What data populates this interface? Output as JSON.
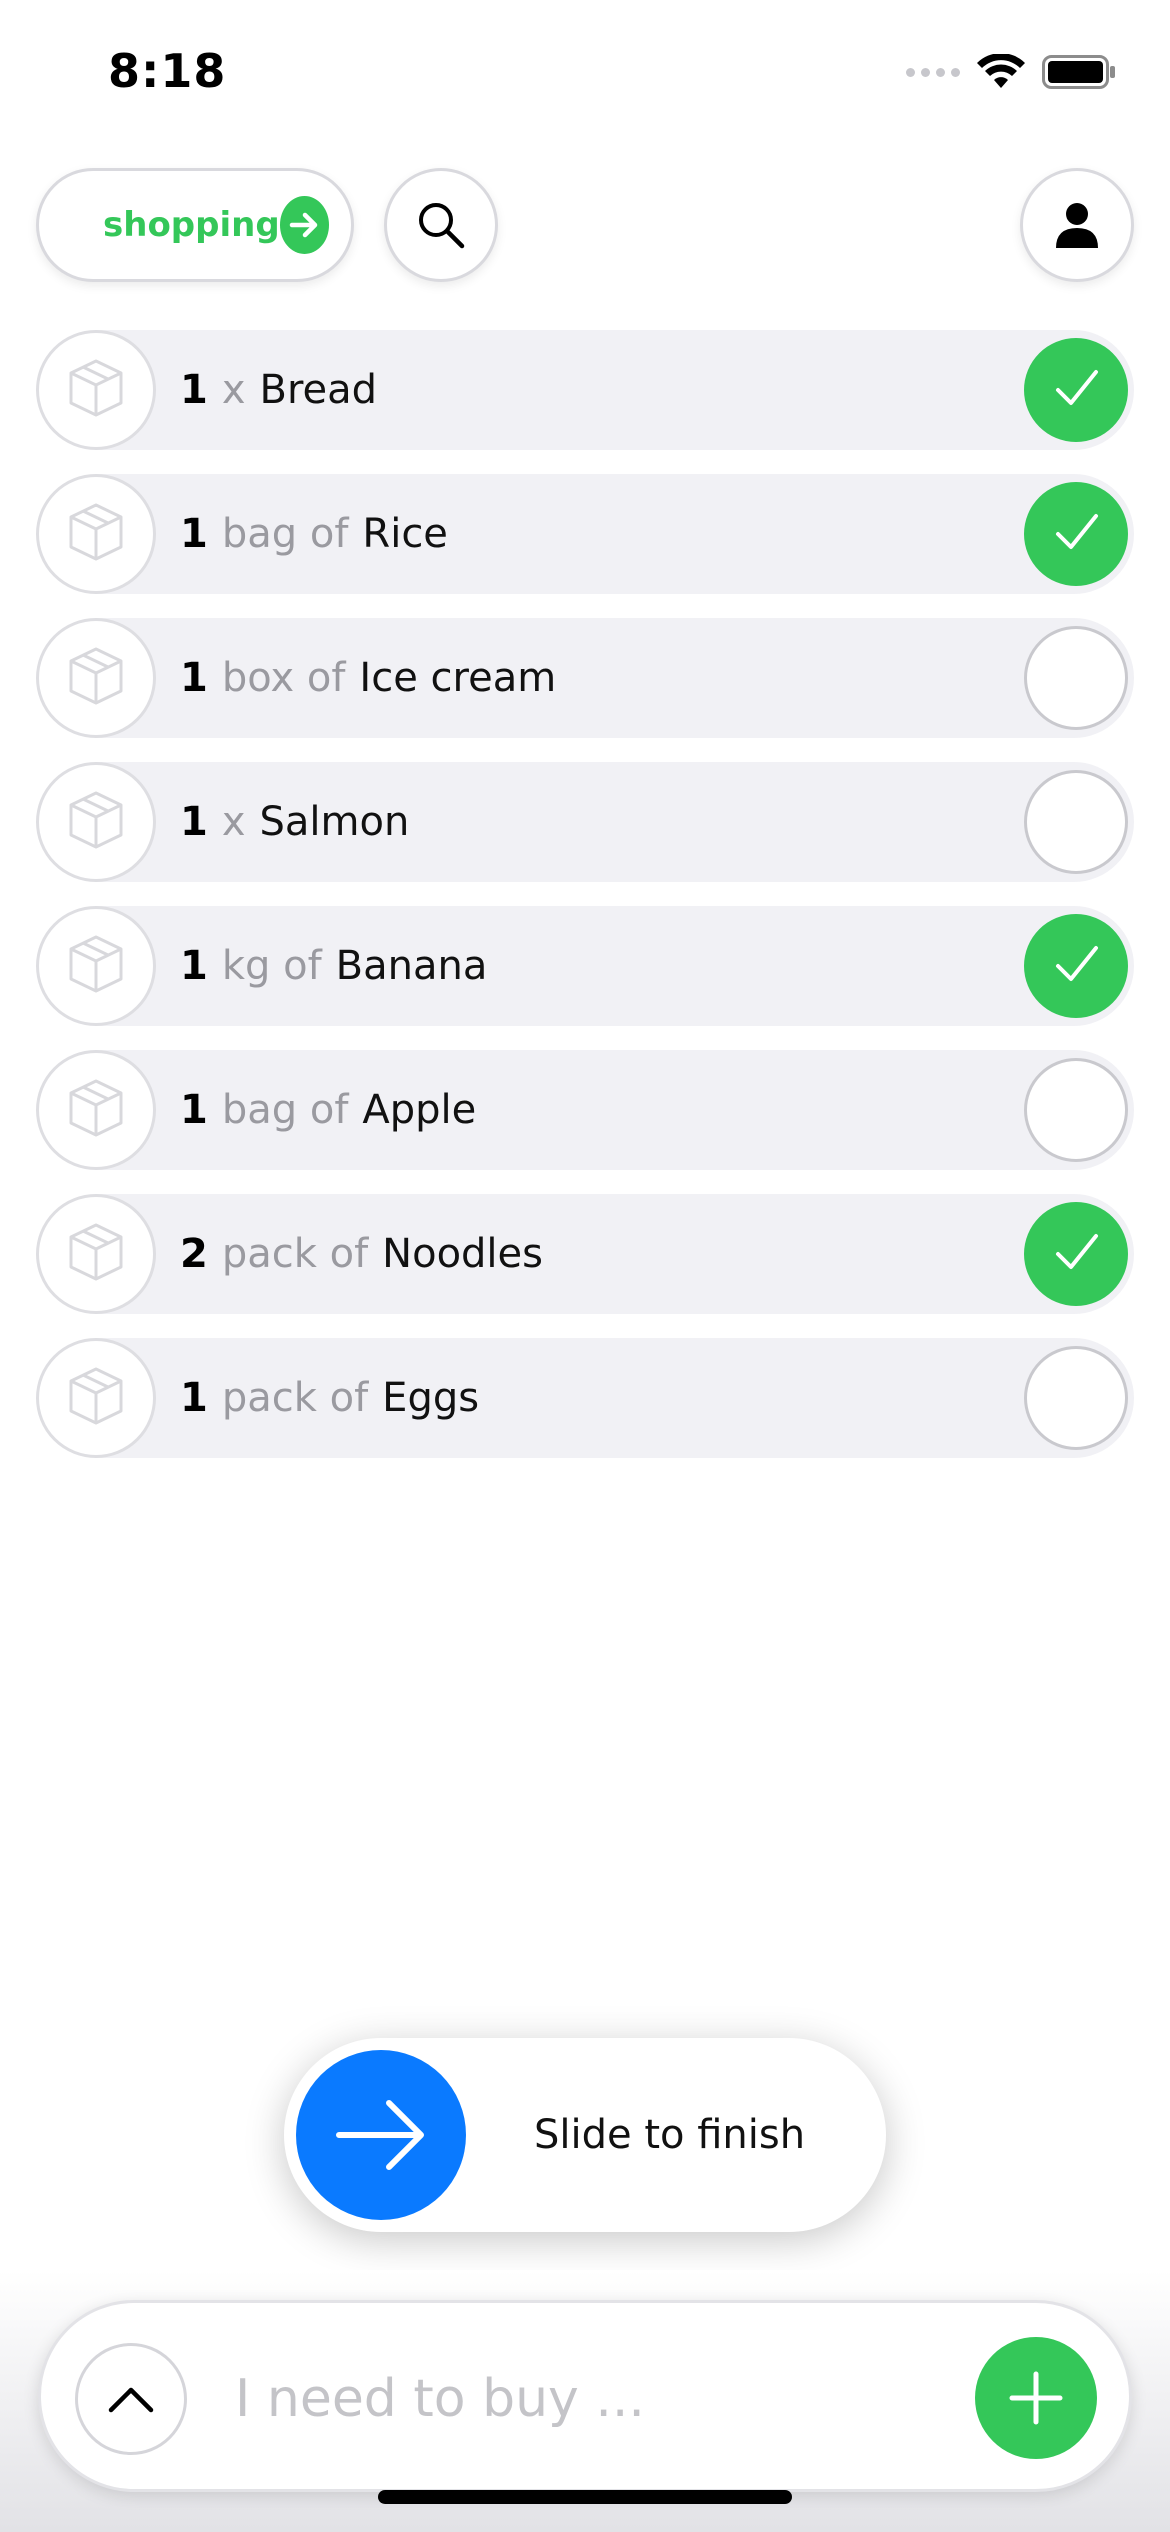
{
  "status_bar": {
    "time": "8:18",
    "icons": [
      "cellular-signal-icon",
      "wifi-icon",
      "battery-icon"
    ]
  },
  "header": {
    "list_label": "shopping",
    "list_arrow_icon": "arrow-right-icon",
    "search_icon": "search-icon",
    "profile_icon": "person-icon"
  },
  "colors": {
    "accent_green": "#34c759",
    "slider_blue": "#0a7aff",
    "row_background": "#f1f1f5",
    "unit_gray": "#9a9aa0"
  },
  "items": [
    {
      "qty": "1",
      "unit": "x",
      "name": "Bread",
      "checked": true,
      "icon": "box-icon"
    },
    {
      "qty": "1",
      "unit": "bag of",
      "name": "Rice",
      "checked": true,
      "icon": "box-icon"
    },
    {
      "qty": "1",
      "unit": "box of",
      "name": "Ice cream",
      "checked": false,
      "icon": "box-icon"
    },
    {
      "qty": "1",
      "unit": "x",
      "name": "Salmon",
      "checked": false,
      "icon": "box-icon"
    },
    {
      "qty": "1",
      "unit": "kg of",
      "name": "Banana",
      "checked": true,
      "icon": "box-icon"
    },
    {
      "qty": "1",
      "unit": "bag of",
      "name": "Apple",
      "checked": false,
      "icon": "box-icon"
    },
    {
      "qty": "2",
      "unit": "pack of",
      "name": "Noodles",
      "checked": true,
      "icon": "box-icon"
    },
    {
      "qty": "1",
      "unit": "pack of",
      "name": "Eggs",
      "checked": false,
      "icon": "box-icon"
    }
  ],
  "slider": {
    "label": "Slide to finish",
    "icon": "arrow-right-icon"
  },
  "input_bar": {
    "placeholder": "I need to buy ...",
    "value": "",
    "expand_icon": "chevron-up-icon",
    "add_icon": "plus-icon"
  }
}
